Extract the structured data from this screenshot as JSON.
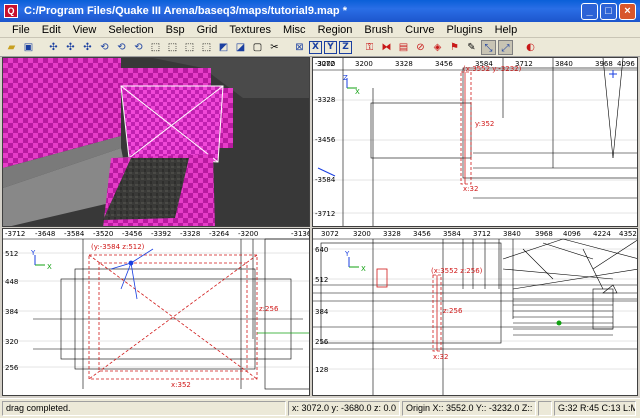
{
  "window": {
    "title": "C:/Program Files/Quake III Arena/baseq3/maps/tutorial9.map *",
    "app_icon": "radiant-icon",
    "controls": [
      "minimize",
      "maximize",
      "close"
    ]
  },
  "menu": [
    "File",
    "Edit",
    "View",
    "Selection",
    "Bsp",
    "Grid",
    "Textures",
    "Misc",
    "Region",
    "Brush",
    "Curve",
    "Plugins",
    "Help"
  ],
  "toolbar": {
    "tools": [
      "open-icon",
      "save-icon",
      "flip-x-icon",
      "flip-y-icon",
      "flip-z-icon",
      "rotate-x-icon",
      "rotate-y-icon",
      "rotate-z-icon",
      "select-complete-tall-icon",
      "select-touching-icon",
      "select-partial-tall-icon",
      "select-inside-icon",
      "csg-subtract-icon",
      "csg-merge-icon",
      "hollow-icon",
      "clipper-icon",
      "change-views-icon",
      "x-axis-icon",
      "y-axis-icon",
      "z-axis-icon",
      "texture-lock-icon",
      "cubic-clip-icon",
      "camera-icon",
      "entity-icon",
      "show-patches-icon",
      "patch-icon",
      "scale-icon",
      "drag-vertices-icon",
      "drag-edges-icon",
      "bend-icon"
    ],
    "axis_buttons": [
      "X",
      "Y",
      "Z"
    ]
  },
  "views": {
    "top_right": {
      "x_ticks": [
        "3072",
        "3200",
        "3328",
        "3456",
        "3584",
        "3712",
        "3840",
        "3968",
        "4096"
      ],
      "y_ticks": [
        "-3200",
        "-3328",
        "-3456",
        "-3584",
        "-3712"
      ],
      "axis_x": "X",
      "axis_y": "Z",
      "readout": "(x:3552 y:-3232)",
      "dim_y": "y:352",
      "dim_x": "x:32"
    },
    "bottom_left": {
      "x_ticks": [
        "-3712",
        "-3648",
        "-3584",
        "-3520",
        "-3456",
        "-3392",
        "-3328",
        "-3264",
        "-3200",
        "-3136"
      ],
      "y_ticks": [
        "512",
        "448",
        "384",
        "320",
        "256"
      ],
      "axis_x": "X",
      "axis_y": "Y",
      "readout": "(y:-3584 z:512)",
      "dim_y": "z:256",
      "dim_x": "x:352"
    },
    "bottom_right": {
      "x_ticks": [
        "3072",
        "3200",
        "3328",
        "3456",
        "3584",
        "3712",
        "3840",
        "3968",
        "4096",
        "4224",
        "4352"
      ],
      "y_ticks": [
        "640",
        "512",
        "384",
        "256",
        "128"
      ],
      "axis_x": "X",
      "axis_y": "Y",
      "readout": "(x:3552 z:256)",
      "dim_y": "z:256",
      "dim_x": "x:32"
    }
  },
  "status": {
    "message": "drag completed.",
    "coords": "x: 3072.0  y: -3680.0  z: 0.0",
    "origin": "Origin X:: 3552.0  Y:: -3232.0  Z:: 288.0",
    "grid": "G:32 R:45 C:13 L:MR"
  },
  "colors": {
    "title_blue": "#0a5fd8",
    "grid_line": "#000000",
    "selection": "#d01818",
    "texture_magenta": "#e020c8",
    "axis_green": "#10a010",
    "axis_blue": "#1a3fe0"
  }
}
